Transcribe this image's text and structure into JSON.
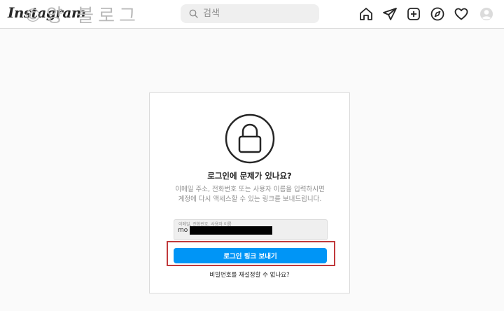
{
  "header": {
    "logo_text": "Instagram",
    "watermark_text": "©양 블로그",
    "search_placeholder": "검색",
    "nav_icons": [
      "home-icon",
      "direct-message-icon",
      "new-post-icon",
      "explore-icon",
      "activity-heart-icon",
      "profile-avatar-icon"
    ]
  },
  "card": {
    "icon": "lock-icon",
    "title": "로그인에 문제가 있나요?",
    "description": "이메일 주소, 전화번호 또는 사용자 이름을 입력하시면 계정에 다시 액세스할 수 있는 링크를 보내드립니다.",
    "input": {
      "label": "이메일, 전화번호, 사용자 이름",
      "value_visible_prefix": "mo"
    },
    "send_button_label": "로그인 링크 보내기",
    "reset_link_label": "비밀번호를 재설정할 수 없나요?"
  },
  "colors": {
    "button": "#0095f6",
    "highlight_box": "#c0393b",
    "border": "#dbdbdb",
    "background": "#fafafa"
  }
}
